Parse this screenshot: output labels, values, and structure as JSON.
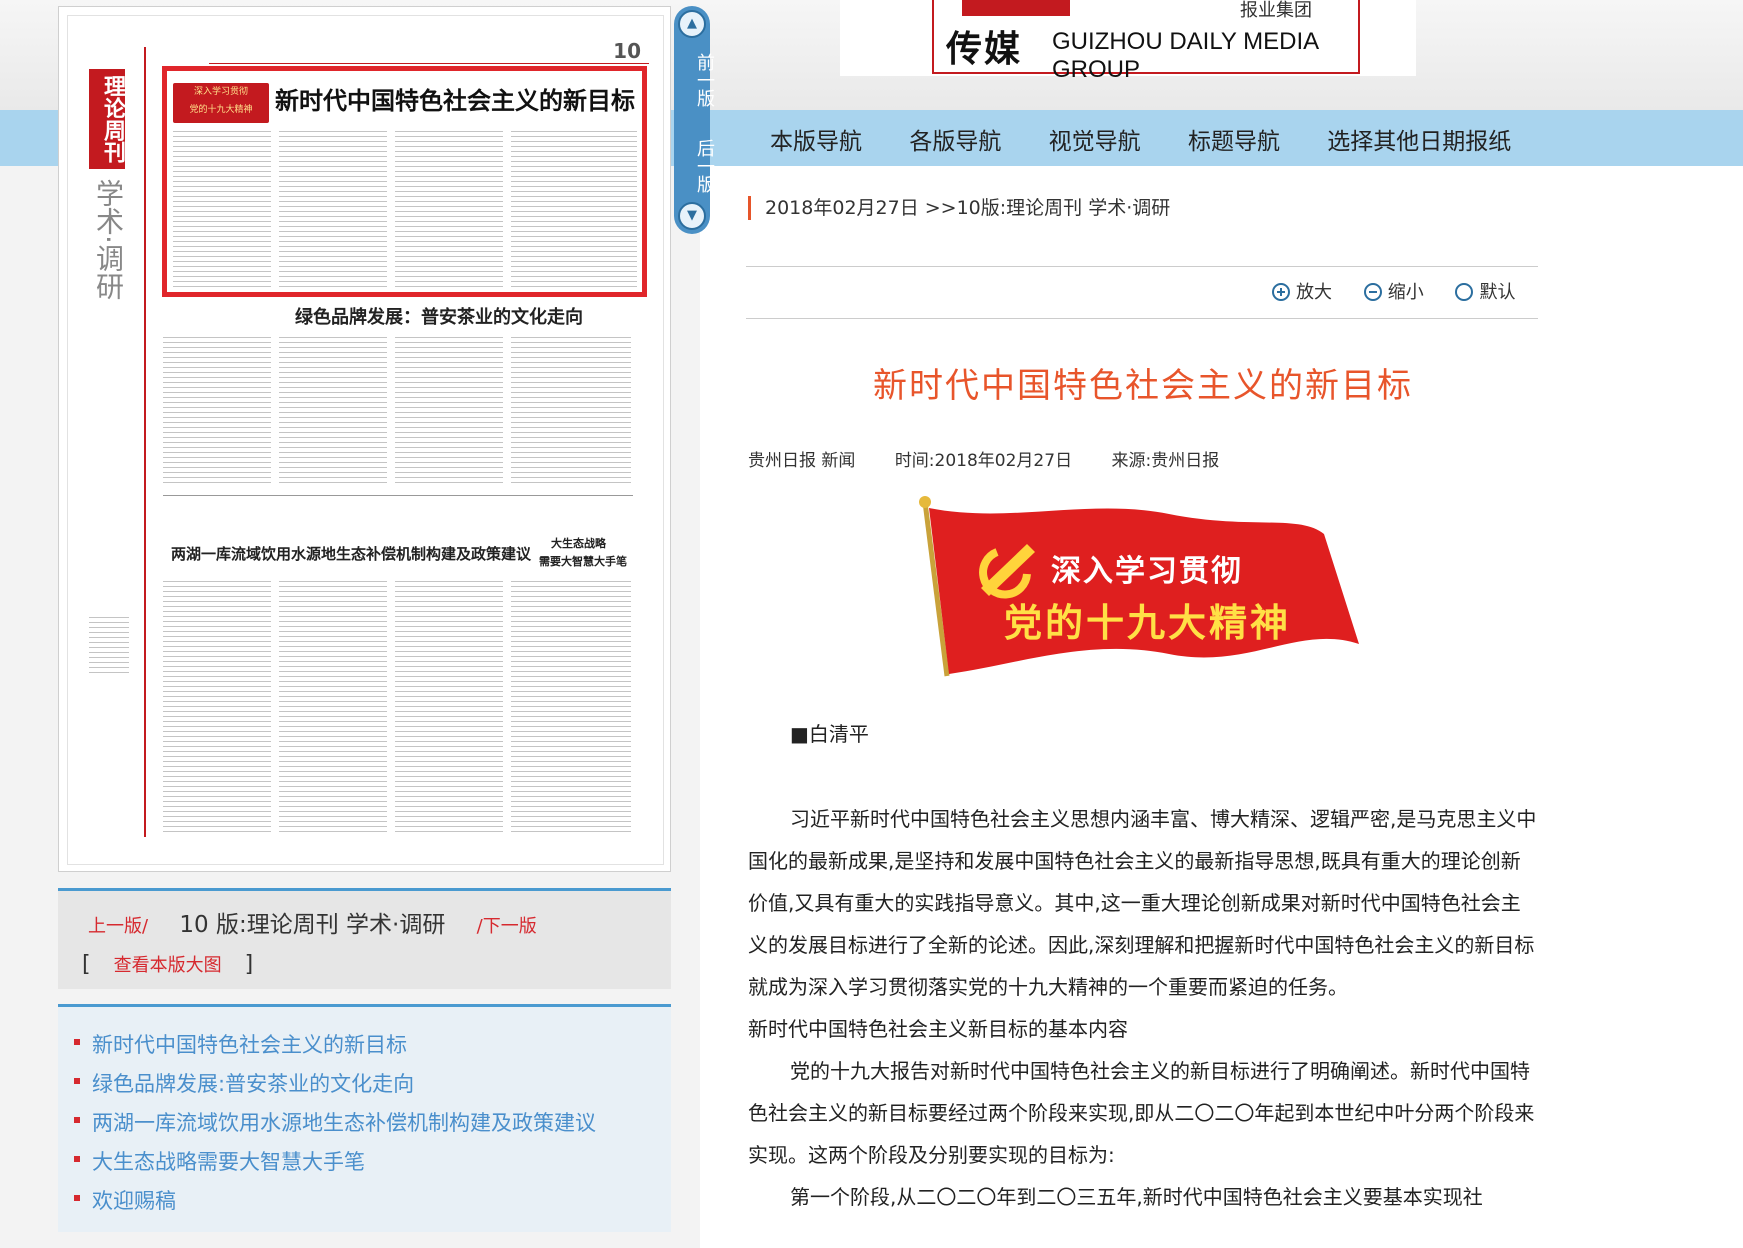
{
  "header": {
    "logo_cn": "传媒",
    "logo_en": "GUIZHOU DAILY MEDIA GROUP",
    "logo_top": "报业集团"
  },
  "nav": {
    "items": [
      "本版导航",
      "各版导航",
      "视觉导航",
      "标题导航",
      "选择其他日期报纸"
    ]
  },
  "breadcrumb": "2018年02月27日 >>10版:理论周刊 学术·调研",
  "zoom": {
    "in": "放大",
    "out": "缩小",
    "reset": "默认"
  },
  "sidebar_vbar": {
    "prev": "前一版",
    "next": "后一版"
  },
  "paper": {
    "column_label_red": "理论周刊",
    "column_label_rest": "学术·调研",
    "page_num": "10",
    "headline": "新时代中国特色社会主义的新目标",
    "badge_line1": "深入学习贯彻",
    "badge_line2": "党的十九大精神",
    "headline2": "绿色品牌发展：普安茶业的文化走向",
    "headline3": "两湖一库流域饮用水源地生态补偿机制构建及政策建议",
    "headline4_line1": "大生态战略",
    "headline4_line2": "需要大智慧大手笔"
  },
  "pager": {
    "prev": "上一版/",
    "current": "10 版:理论周刊 学术·调研",
    "next": "/下一版",
    "bracket_open": "[",
    "view_large": "查看本版大图",
    "bracket_close": "]"
  },
  "article_list": [
    "新时代中国特色社会主义的新目标",
    "绿色品牌发展:普安茶业的文化走向",
    "两湖一库流域饮用水源地生态补偿机制构建及政策建议",
    "大生态战略需要大智慧大手笔",
    "欢迎赐稿"
  ],
  "article": {
    "title": "新时代中国特色社会主义的新目标",
    "meta_source_paper": "贵州日报 新闻",
    "meta_time": "时间:2018年02月27日",
    "meta_from": "来源:贵州日报",
    "banner_line1": "深入学习贯彻",
    "banner_line2": "党的十九大精神",
    "author": "■白清平",
    "paragraphs": [
      "习近平新时代中国特色社会主义思想内涵丰富、博大精深、逻辑严密,是马克思主义中国化的最新成果,是坚持和发展中国特色社会主义的最新指导思想,既具有重大的理论创新价值,又具有重大的实践指导意义。其中,这一重大理论创新成果对新时代中国特色社会主义的发展目标进行了全新的论述。因此,深刻理解和把握新时代中国特色社会主义的新目标就成为深入学习贯彻落实党的十九大精神的一个重要而紧迫的任务。",
      "新时代中国特色社会主义新目标的基本内容",
      "党的十九大报告对新时代中国特色社会主义的新目标进行了明确阐述。新时代中国特色社会主义的新目标要经过两个阶段来实现,即从二〇二〇年起到本世纪中叶分两个阶段来实现。这两个阶段及分别要实现的目标为:",
      "第一个阶段,从二〇二〇年到二〇三五年,新时代中国特色社会主义要基本实现社"
    ]
  },
  "colors": {
    "accent_red": "#e0262b",
    "nav_blue": "#a9d4ee",
    "link_blue": "#4a8fcc",
    "title_orange": "#e8552b"
  }
}
